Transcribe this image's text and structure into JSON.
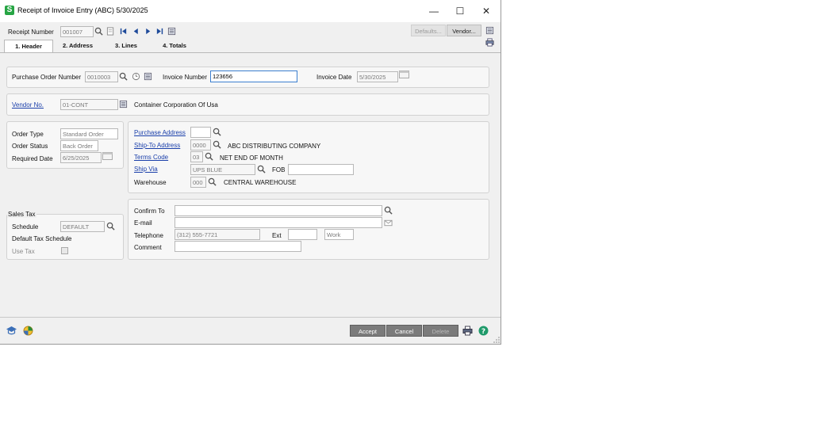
{
  "window": {
    "title": "Receipt of Invoice Entry (ABC) 5/30/2025",
    "app_icon_letter": "S",
    "minimize": "—",
    "maximize": "☐",
    "close": "✕"
  },
  "toolbar": {
    "receipt_number_label": "Receipt Number",
    "receipt_number_value": "001007",
    "defaults_label": "Defaults...",
    "vendor_label": "Vendor..."
  },
  "tabs": [
    {
      "label": "1. Header"
    },
    {
      "label": "2. Address"
    },
    {
      "label": "3. Lines"
    },
    {
      "label": "4. Totals"
    }
  ],
  "header": {
    "po_number_label": "Purchase Order Number",
    "po_number_value": "0010003",
    "invoice_number_label": "Invoice Number",
    "invoice_number_value": "123656",
    "invoice_date_label": "Invoice Date",
    "invoice_date_value": "5/30/2025",
    "vendor_no_label": "Vendor No.",
    "vendor_no_value": "01-CONT",
    "vendor_name": "Container Corporation Of Usa",
    "order_type_label": "Order Type",
    "order_type_value": "Standard Order",
    "order_status_label": "Order Status",
    "order_status_value": "Back Order",
    "required_date_label": "Required Date",
    "required_date_value": "6/25/2025",
    "purchase_address_label": "Purchase Address",
    "purchase_address_value": "",
    "ship_to_label": "Ship-To Address",
    "ship_to_value": "0000",
    "ship_to_name": "ABC DISTRIBUTING COMPANY",
    "terms_label": "Terms Code",
    "terms_value": "03",
    "terms_desc": "NET END OF MONTH",
    "ship_via_label": "Ship Via",
    "ship_via_value": "UPS BLUE",
    "fob_label": "FOB",
    "fob_value": "",
    "warehouse_label": "Warehouse",
    "warehouse_value": "000",
    "warehouse_desc": "CENTRAL WAREHOUSE",
    "sales_tax_label": "Sales Tax",
    "schedule_label": "Schedule",
    "schedule_value": "DEFAULT",
    "default_tax_schedule_label": "Default Tax Schedule",
    "use_tax_label": "Use Tax",
    "confirm_to_label": "Confirm To",
    "confirm_to_value": "",
    "email_label": "E-mail",
    "email_value": "",
    "telephone_label": "Telephone",
    "telephone_value": "(312) 555-7721",
    "ext_label": "Ext",
    "ext_value": "",
    "work_value": "Work",
    "comment_label": "Comment",
    "comment_value": ""
  },
  "footer": {
    "accept_label": "Accept",
    "cancel_label": "Cancel",
    "delete_label": "Delete"
  },
  "colors": {
    "link": "#1a3faa",
    "accent_button": "#7b7b7b",
    "app_green": "#27a544"
  }
}
